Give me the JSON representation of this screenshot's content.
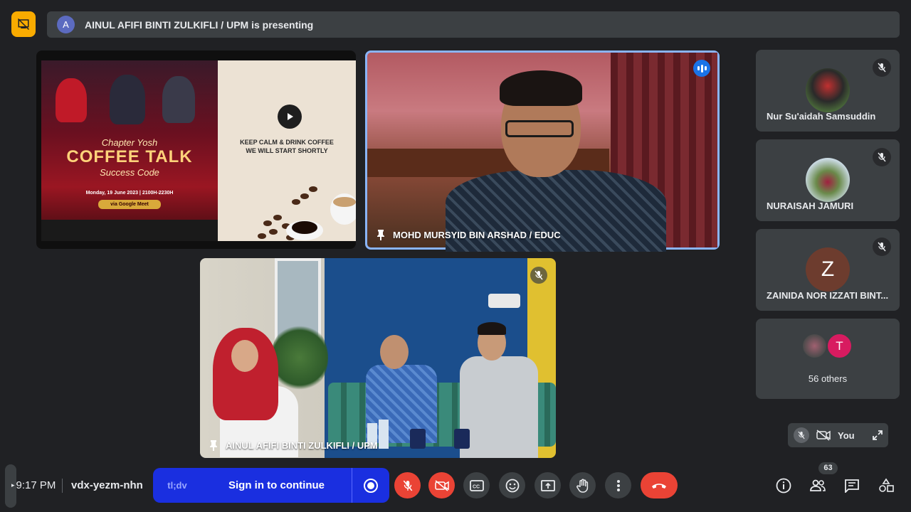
{
  "presenting_bar": {
    "avatar_initial": "A",
    "text": "AINUL AFIFI BINTI ZULKIFLI / UPM is presenting"
  },
  "presentation": {
    "poster": {
      "subtitle": "Chapter Yosh",
      "title": "COFFEE TALK",
      "tagline": "Success Code",
      "date": "Monday, 19 June 2023 | 2100H-2230H",
      "platform": "via Google Meet"
    },
    "slide_text_line1": "KEEP CALM & DRINK COFFEE",
    "slide_text_line2": "WE WILL START SHORTLY"
  },
  "tiles": {
    "speaker_name": "MOHD MURSYID BIN ARSHAD / EDUC",
    "room_name": "AINUL AFIFI BINTI ZULKIFLI / UPM"
  },
  "sidebar": {
    "participants": [
      {
        "name": "Nur Su'aidah Samsuddin"
      },
      {
        "name": "NURAISAH JAMURI"
      },
      {
        "name": "ZAINIDA NOR IZZATI BINT...",
        "initial": "Z"
      }
    ],
    "others": {
      "initial": "T",
      "label": "56 others"
    }
  },
  "self_view": {
    "label": "You"
  },
  "bottom_bar": {
    "time": "9:17 PM",
    "meeting_code": "vdx-yezm-nhn",
    "signin_logo": "tl;dv",
    "signin_label": "Sign in to continue",
    "people_count": "63"
  },
  "colors": {
    "background": "#202124",
    "tile": "#3c4043",
    "accent_blue": "#1a73e8",
    "danger_red": "#ea4335",
    "host_yellow": "#f9ab00",
    "signin_blue": "#1a2fe0"
  }
}
